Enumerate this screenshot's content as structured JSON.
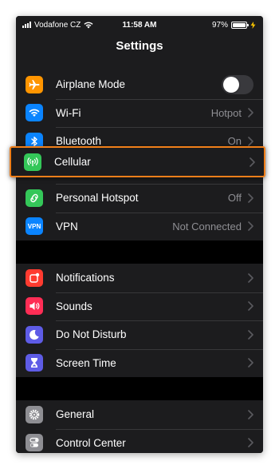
{
  "status_bar": {
    "carrier": "Vodafone CZ",
    "time": "11:58 AM",
    "battery": "97%",
    "battery_level": 0.97
  },
  "nav": {
    "title": "Settings"
  },
  "groups": [
    {
      "rows": [
        {
          "label": "Airplane Mode",
          "icon": "airplane-icon",
          "color": "#ff9500",
          "toggle": false
        },
        {
          "label": "Wi-Fi",
          "icon": "wifi-icon",
          "color": "#0a84ff",
          "value": "Hotpot"
        },
        {
          "label": "Bluetooth",
          "icon": "bluetooth-icon",
          "color": "#0a84ff",
          "value": "On"
        },
        {
          "label": "Cellular",
          "icon": "cellular-antenna-icon",
          "color": "#34c759",
          "highlighted": true
        },
        {
          "label": "Personal Hotspot",
          "icon": "hotspot-link-icon",
          "color": "#34c759",
          "value": "Off"
        },
        {
          "label": "VPN",
          "icon": "vpn-icon",
          "color": "#0a84ff",
          "value": "Not Connected",
          "icon_text": "VPN"
        }
      ]
    },
    {
      "rows": [
        {
          "label": "Notifications",
          "icon": "notifications-icon",
          "color": "#ff3b30"
        },
        {
          "label": "Sounds",
          "icon": "speaker-icon",
          "color": "#ff2d55"
        },
        {
          "label": "Do Not Disturb",
          "icon": "moon-icon",
          "color": "#5e5ce6"
        },
        {
          "label": "Screen Time",
          "icon": "hourglass-icon",
          "color": "#5e5ce6"
        }
      ]
    },
    {
      "rows": [
        {
          "label": "General",
          "icon": "gear-icon",
          "color": "#8e8e93"
        },
        {
          "label": "Control Center",
          "icon": "toggles-icon",
          "color": "#8e8e93"
        }
      ]
    }
  ],
  "highlight_color": "#f07f1a"
}
